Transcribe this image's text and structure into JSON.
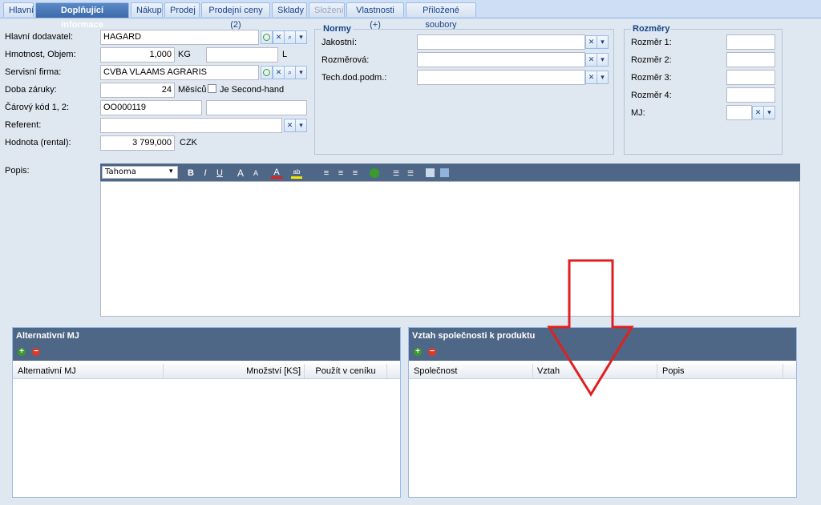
{
  "tabs": [
    {
      "label": "Hlavní"
    },
    {
      "label": "Doplňující informace"
    },
    {
      "label": "Nákup"
    },
    {
      "label": "Prodej"
    },
    {
      "label": "Prodejní ceny (2)"
    },
    {
      "label": "Sklady"
    },
    {
      "label": "Složení"
    },
    {
      "label": "Vlastnosti (+)"
    },
    {
      "label": "Přiložené soubory"
    }
  ],
  "form": {
    "supplier_label": "Hlavní dodavatel:",
    "supplier_value": "HAGARD",
    "weight_label": "Hmotnost, Objem:",
    "weight_value": "1,000",
    "weight_unit": "KG",
    "volume_value": "",
    "volume_unit": "L",
    "service_label": "Servisní firma:",
    "service_value": "CVBA VLAAMS AGRARIS",
    "warranty_label": "Doba záruky:",
    "warranty_value": "24",
    "warranty_unit": "Měsíců",
    "second_hand_label": "Je Second-hand",
    "barcode_label": "Čárový kód 1, 2:",
    "barcode1_value": "OO000119",
    "barcode2_value": "",
    "referent_label": "Referent:",
    "referent_value": "",
    "rental_label": "Hodnota (rental):",
    "rental_value": "3 799,000",
    "rental_unit": "CZK",
    "description_label": "Popis:"
  },
  "norms": {
    "legend": "Normy",
    "quality_label": "Jakostní:",
    "dimension_label": "Rozměrová:",
    "tech_label": "Tech.dod.podm.:"
  },
  "dimensions": {
    "legend": "Rozměry",
    "dim1_label": "Rozměr 1:",
    "dim2_label": "Rozměr 2:",
    "dim3_label": "Rozměr 3:",
    "dim4_label": "Rozměr 4:",
    "mj_label": "MJ:"
  },
  "editor": {
    "font_value": "Tahoma"
  },
  "alt_mj_panel": {
    "title": "Alternativní MJ",
    "columns": [
      "Alternativní MJ",
      "Množství [KS]",
      "Použít v ceníku"
    ]
  },
  "company_panel": {
    "title": "Vztah společnosti k produktu",
    "columns": [
      "Společnost",
      "Vztah",
      "Popis"
    ]
  },
  "colors": {
    "accent_arrow": "#e02020",
    "header_bg": "#4f6786",
    "active_tab": "#3d6aa9"
  }
}
